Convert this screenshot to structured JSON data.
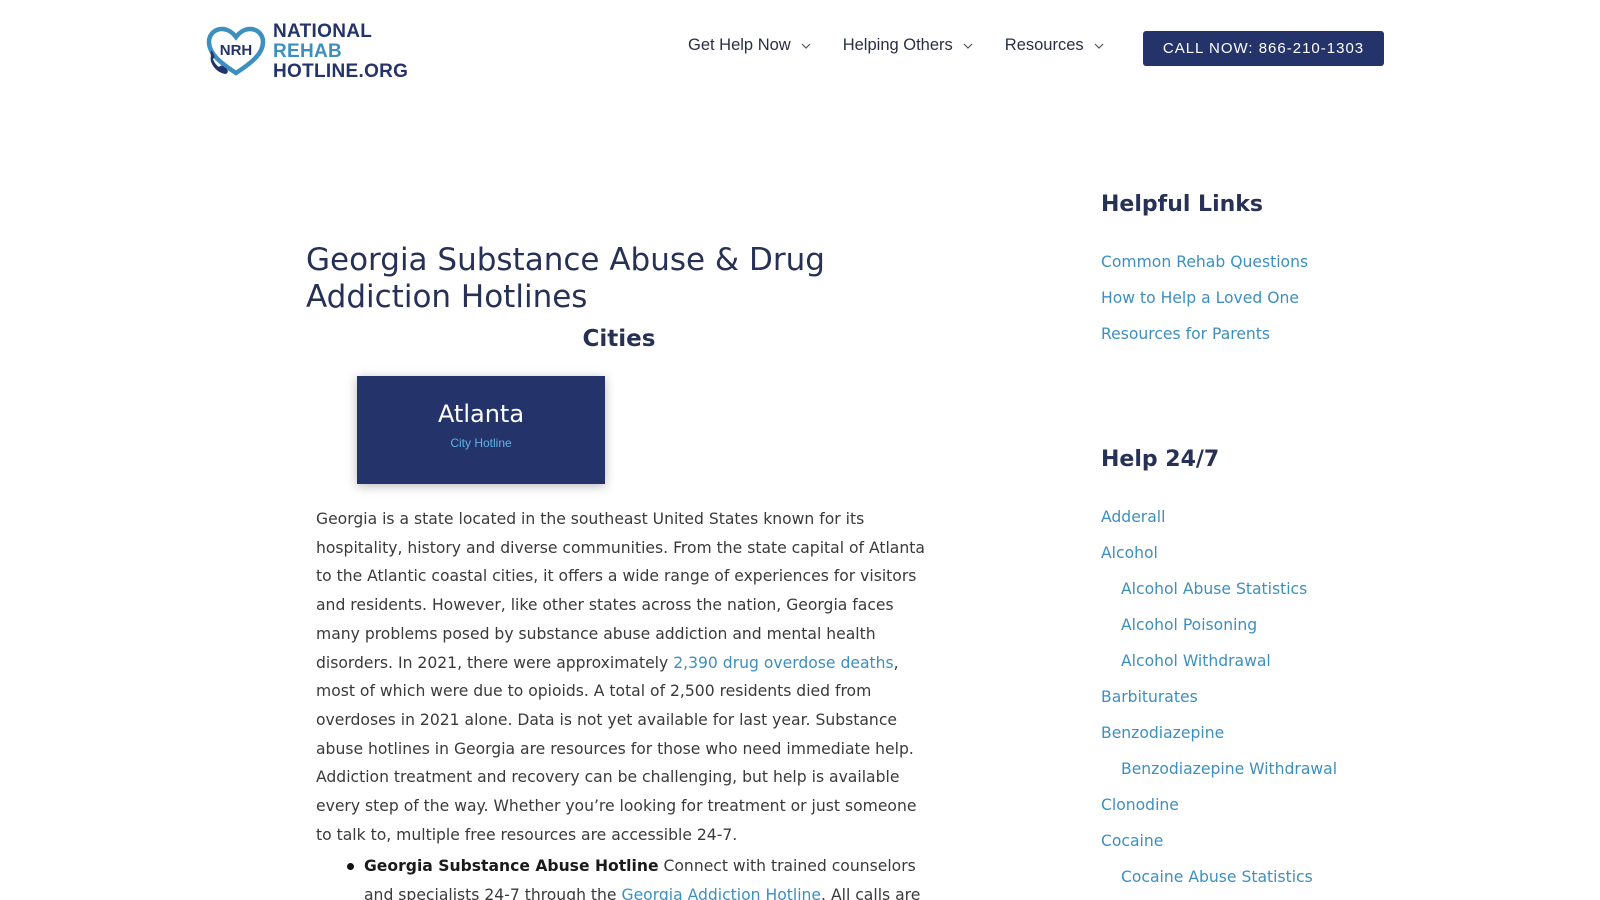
{
  "header": {
    "logo": {
      "badge": "NRH",
      "line1": "NATIONAL",
      "line2": "REHAB",
      "line3": "HOTLINE.ORG"
    },
    "nav": [
      {
        "label": "Get Help Now"
      },
      {
        "label": "Helping Others"
      },
      {
        "label": "Resources"
      }
    ],
    "cta_label": "CALL NOW: 866-210-1303"
  },
  "main": {
    "title": "Georgia Substance Abuse & Drug Addiction Hotlines",
    "cities_heading": "Cities",
    "city_card": {
      "name": "Atlanta",
      "subtitle": "City Hotline"
    },
    "intro_part1": "Georgia is a state located in the southeast United States known for its hospitality, history and diverse communities. From the state capital of Atlanta to the Atlantic coastal cities, it offers a wide range of experiences for visitors and residents. However, like other states across the nation, Georgia faces many problems posed by substance abuse addiction and mental health disorders. In 2021, there were approximately ",
    "intro_link": "2,390 drug overdose deaths",
    "intro_part2": ", most of which were due to opioids. A total of 2,500 residents died from overdoses in 2021 alone. Data is not yet available for last year. Substance abuse hotlines in Georgia are resources for those who need immediate help. Addiction treatment and recovery can be challenging, but help is available every step of the way. Whether you’re looking for treatment or just someone to talk to, multiple free resources are accessible 24-7.",
    "bullet": {
      "bold": "Georgia Substance Abuse Hotline",
      "text1": " Connect with trained counselors and specialists 24-7 through the ",
      "link": "Georgia Addiction Hotline",
      "text2": ". All calls are free"
    }
  },
  "sidebar": {
    "helpful_heading": "Helpful Links",
    "helpful_links": [
      "Common Rehab Questions",
      "How to Help a Loved One",
      "Resources for Parents"
    ],
    "help_heading": "Help 24/7",
    "help_links": [
      {
        "label": "Adderall"
      },
      {
        "label": "Alcohol"
      },
      {
        "label": "Alcohol Abuse Statistics"
      },
      {
        "label": "Alcohol Poisoning"
      },
      {
        "label": "Alcohol Withdrawal"
      },
      {
        "label": "Barbiturates"
      },
      {
        "label": "Benzodiazepine"
      },
      {
        "label": "Benzodiazepine Withdrawal"
      },
      {
        "label": "Clonodine"
      },
      {
        "label": "Cocaine"
      },
      {
        "label": "Cocaine Abuse Statistics"
      }
    ]
  },
  "colors": {
    "brand_navy": "#24346b",
    "link_blue": "#3d8fbf",
    "heading": "#273155"
  },
  "icons": {
    "logo": "heart-phone-icon",
    "nav_chevron": "chevron-down-icon"
  }
}
